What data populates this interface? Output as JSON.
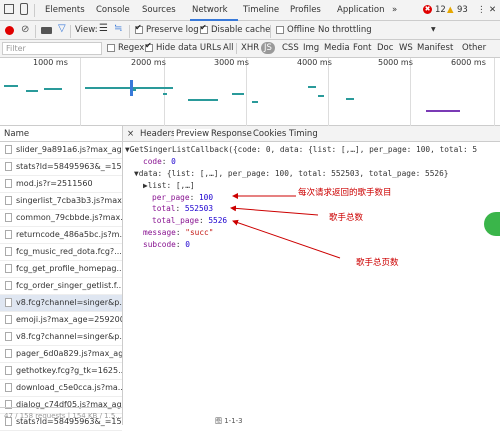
{
  "devtools": {
    "tabs": [
      {
        "label": "Elements"
      },
      {
        "label": "Console"
      },
      {
        "label": "Sources"
      },
      {
        "label": "Network"
      },
      {
        "label": "Timeline"
      },
      {
        "label": "Profiles"
      },
      {
        "label": "Application"
      },
      {
        "label": "»"
      }
    ],
    "error_count": "12",
    "warning_count": "93"
  },
  "toolbar": {
    "view_label": "View:",
    "preserve_log": "Preserve log",
    "disable_cache": "Disable cache",
    "offline": "Offline",
    "throttling": "No throttling",
    "dropdown_arrow": "▼"
  },
  "filter": {
    "placeholder": "Filter",
    "regex": "Regex",
    "hide_data_urls": "Hide data URLs",
    "types": [
      "All",
      "XHR",
      "JS",
      "CSS",
      "Img",
      "Media",
      "Font",
      "Doc",
      "WS",
      "Manifest",
      "Other"
    ]
  },
  "overview": {
    "ticks": [
      "1000 ms",
      "2000 ms",
      "3000 ms",
      "4000 ms",
      "5000 ms",
      "6000 ms"
    ]
  },
  "requests": {
    "header": "Name",
    "items": [
      "slider_9a891a6.js?max_ag...",
      "stats?ld=58495963&_=15...",
      "mod.js?r=2511560",
      "singerlist_7cba3b3.js?max...",
      "common_79cbbde.js?max...",
      "returncode_486a5bc.js?m...",
      "fcg_music_red_dota.fcg?...",
      "fcg_get_profile_homepag...",
      "fcg_order_singer_getlist.f...",
      "v8.fcg?channel=singer&p...",
      "emoji.js?max_age=2592000",
      "v8.fcg?channel=singer&p...",
      "pager_6d0a829.js?max_ag...",
      "gethotkey.fcg?g_tk=1625...",
      "download_c5e0cca.js?ma...",
      "dialog_c74df05.js?max_ag...",
      "stats?ld=58495963&_=15..."
    ],
    "selected_index": 9,
    "status": "47 / 158 requests | 154 KB / 1.5..."
  },
  "detail": {
    "tabs": [
      "Headers",
      "Preview",
      "Response",
      "Cookies",
      "Timing"
    ],
    "active_tab": "Preview",
    "close": "×"
  },
  "preview": {
    "line1": "▼GetSingerListCallback({code: 0, data: {list: [,…], per_page: 100, total: 5",
    "code_key": "code",
    "code_val": "0",
    "data_line": "▼data: {list: [,…], per_page: 100, total: 552503, total_page: 5526}",
    "list_line": "▶list: [,…]",
    "per_page_key": "per_page",
    "per_page_val": "100",
    "total_key": "total",
    "total_val": "552503",
    "total_page_key": "total_page",
    "total_page_val": "5526",
    "message_key": "message",
    "message_val": "\"succ\"",
    "subcode_key": "subcode",
    "subcode_val": "0"
  },
  "annotations": {
    "per_page_note": "每次请求返回的歌手数目",
    "total_note": "歌手总数",
    "total_page_note": "歌手总页数"
  },
  "caption": "图 1-1-3",
  "colors": {
    "accent": "#3879d9",
    "annotation": "#cc0000",
    "selected_row": "#dfe6f1",
    "record": "#e00000"
  }
}
